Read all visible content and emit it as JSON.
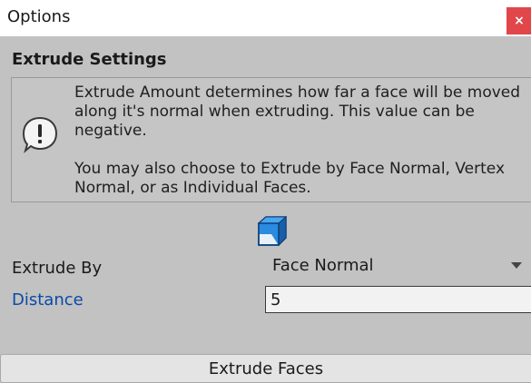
{
  "window": {
    "title": "Options",
    "close_label": "×"
  },
  "section": {
    "title": "Extrude Settings"
  },
  "help": {
    "icon": "warning-icon",
    "paragraph1": "Extrude Amount determines how far a face will be moved along it's normal when extruding.  This value can be negative.",
    "paragraph2": "You may also choose to Extrude by Face Normal, Vertex Normal, or as Individual Faces."
  },
  "mode_icon": "cube-face-icon",
  "extrude_by": {
    "label": "Extrude By",
    "selected": "Face Normal"
  },
  "distance": {
    "label": "Distance",
    "value": "5"
  },
  "action": {
    "label": "Extrude Faces"
  },
  "colors": {
    "panel_bg": "#c2c2c2",
    "close_bg": "#e0464a",
    "distance_label": "#0b4aa8",
    "cube_blue": "#2a8be0"
  }
}
